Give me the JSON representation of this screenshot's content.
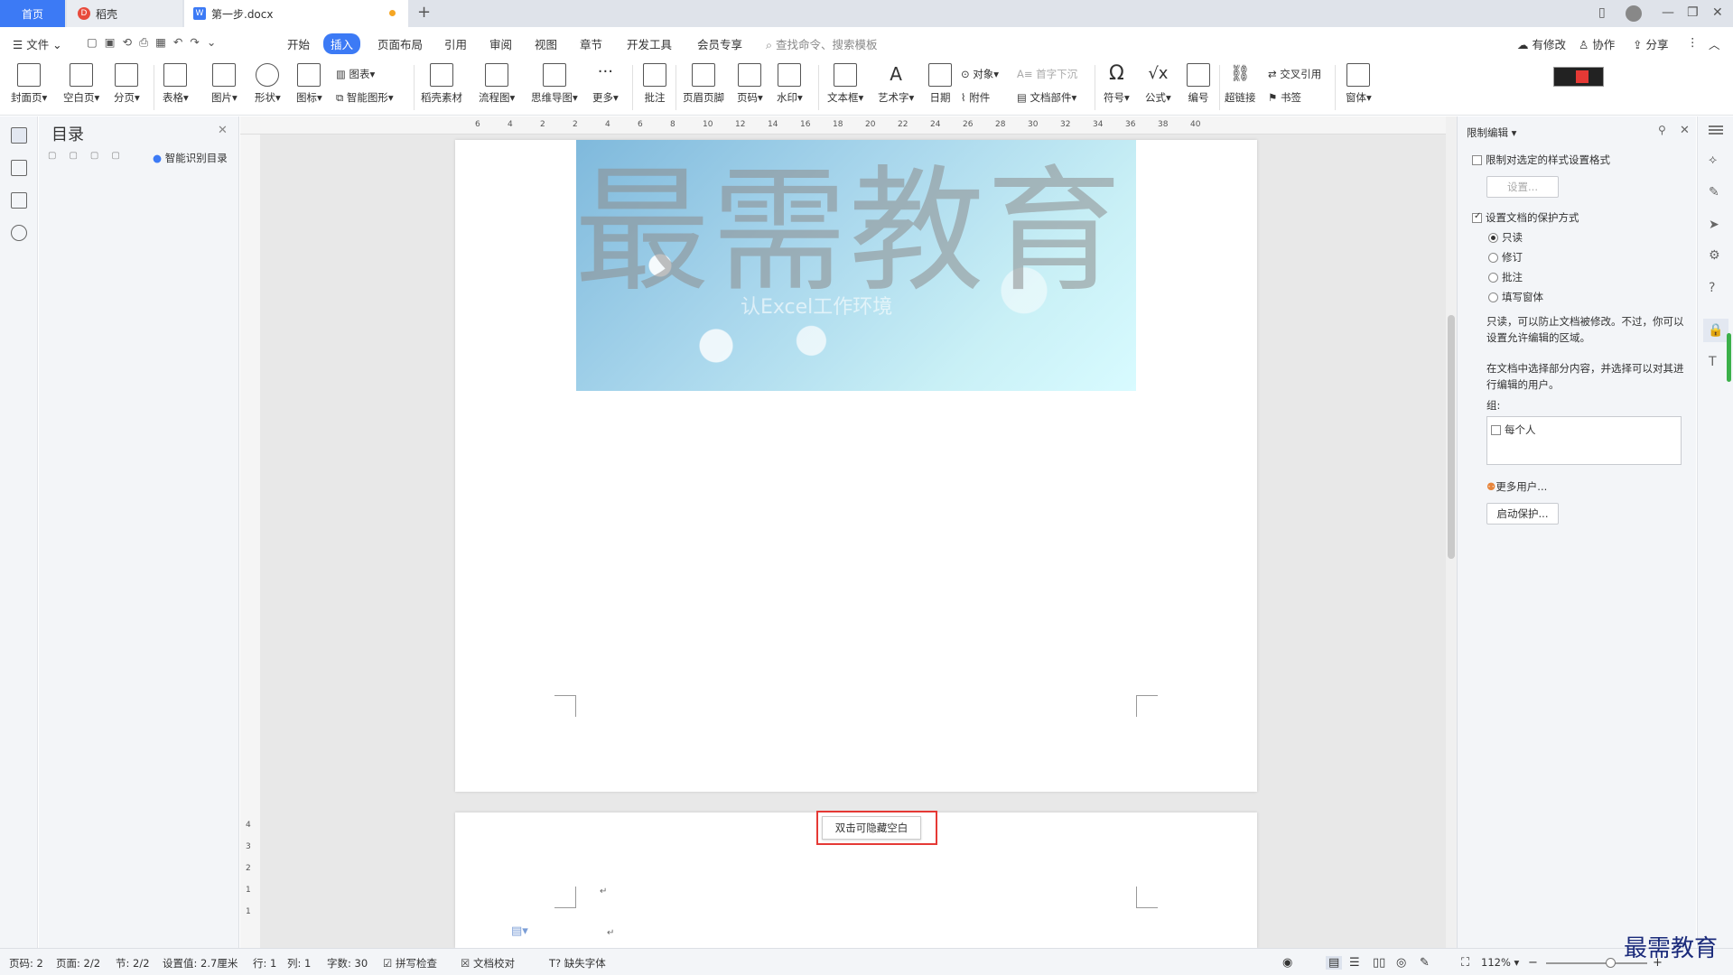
{
  "tabs": {
    "home": "首页",
    "daoke": "稻壳",
    "doc": "第一步.docx"
  },
  "menubar": {
    "file": "文件",
    "items": [
      "开始",
      "插入",
      "页面布局",
      "引用",
      "审阅",
      "视图",
      "章节",
      "开发工具",
      "会员专享"
    ],
    "search_placeholder": "查找命令、搜索模板",
    "has_changes": "有修改",
    "collaborate": "协作",
    "share": "分享"
  },
  "ribbon": {
    "cover": "封面页",
    "blank": "空白页",
    "pagebreak": "分页",
    "table": "表格",
    "picture": "图片",
    "shape": "形状",
    "icon": "图标",
    "chart": "图表",
    "smartart": "智能图形",
    "material": "稻壳素材",
    "flowchart": "流程图",
    "mindmap": "思维导图",
    "more": "更多",
    "comment": "批注",
    "header_footer": "页眉页脚",
    "page_number": "页码",
    "watermark": "水印",
    "textbox": "文本框",
    "wordart": "艺术字",
    "date": "日期",
    "object": "对象",
    "attachment": "附件",
    "dropcap": "首字下沉",
    "docpart": "文档部件",
    "symbol": "符号",
    "formula": "公式",
    "numbering": "编号",
    "hyperlink": "超链接",
    "crossref": "交叉引用",
    "bookmark": "书签",
    "form": "窗体"
  },
  "toc": {
    "title": "目录",
    "smart_toc": "智能识别目录"
  },
  "ruler": {
    "ticks": [
      "6",
      "4",
      "2",
      "2",
      "4",
      "6",
      "8",
      "10",
      "12",
      "14",
      "16",
      "18",
      "20",
      "22",
      "24",
      "26",
      "28",
      "30",
      "32",
      "34",
      "36",
      "38",
      "40"
    ],
    "vticks": [
      "4",
      "3",
      "2",
      "1",
      "1"
    ]
  },
  "document": {
    "watermark": "最需教育",
    "banner_subtitle": "认Excel工作环境",
    "hide_blank_tooltip": "双击可隐藏空白"
  },
  "restrict_panel": {
    "title": "限制编辑",
    "limit_format": "限制对选定的样式设置格式",
    "settings_btn": "设置...",
    "set_protection": "设置文档的保护方式",
    "opt_readonly": "只读",
    "opt_revise": "修订",
    "opt_comment": "批注",
    "opt_form": "填写窗体",
    "desc1": "只读，可以防止文档被修改。不过，你可以设置允许编辑的区域。",
    "desc2": "在文档中选择部分内容，并选择可以对其进行编辑的用户。",
    "group_label": "组:",
    "everyone": "每个人",
    "more_users": "更多用户...",
    "start_protect": "启动保护..."
  },
  "statusbar": {
    "page_code": "页码: 2",
    "page": "页面: 2/2",
    "section": "节: 2/2",
    "setting": "设置值: 2.7厘米",
    "row": "行: 1",
    "col": "列: 1",
    "wordcount": "字数: 30",
    "spellcheck": "拼写检查",
    "proofread": "文档校对",
    "missing_font": "缺失字体",
    "zoom": "112%"
  },
  "corner_brand": "最需教育",
  "colors": {
    "accent": "#3c7af5",
    "highlight": "#e53935"
  }
}
